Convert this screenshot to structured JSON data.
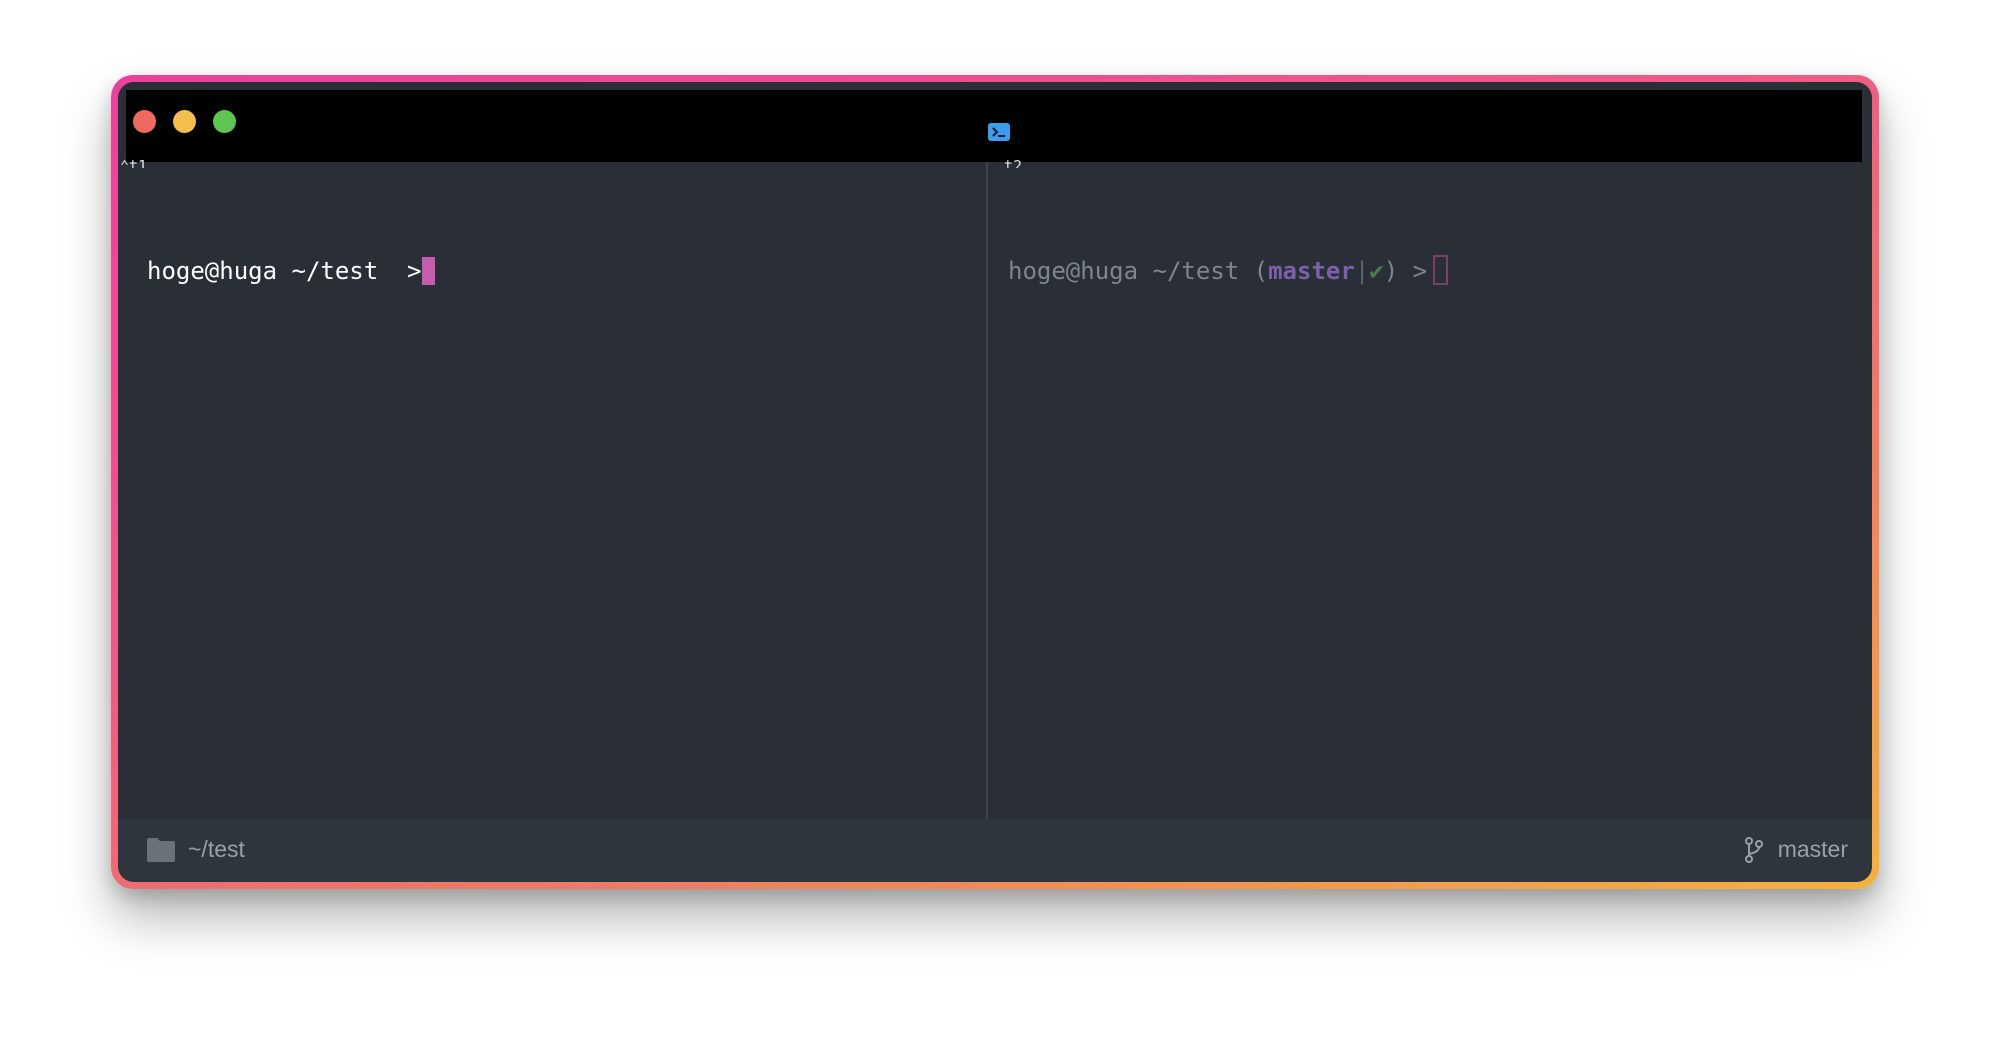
{
  "window": {
    "title_icon": "terminal-icon",
    "traffic_lights": {
      "close_color": "#ef6a5e",
      "minimize_color": "#f5bf4f",
      "maximize_color": "#61c554"
    },
    "frame_gradient": [
      "#e8419d",
      "#ef7d62",
      "#f4b23c"
    ]
  },
  "panes": [
    {
      "tag": "⌃t1",
      "prompt": {
        "user_host": "hoge@huga",
        "path": "~/test",
        "arrow": ">"
      },
      "active": true
    },
    {
      "tag": "t2",
      "prompt": {
        "user_host": "hoge@huga",
        "path": "~/test",
        "open_paren": "(",
        "branch": "master",
        "separator": "|",
        "status": "✔",
        "close_paren": ")",
        "arrow": ">"
      },
      "active": false
    }
  ],
  "statusbar": {
    "directory": "~/test",
    "directory_icon": "folder-icon",
    "branch": "master",
    "branch_icon": "git-branch-icon"
  }
}
